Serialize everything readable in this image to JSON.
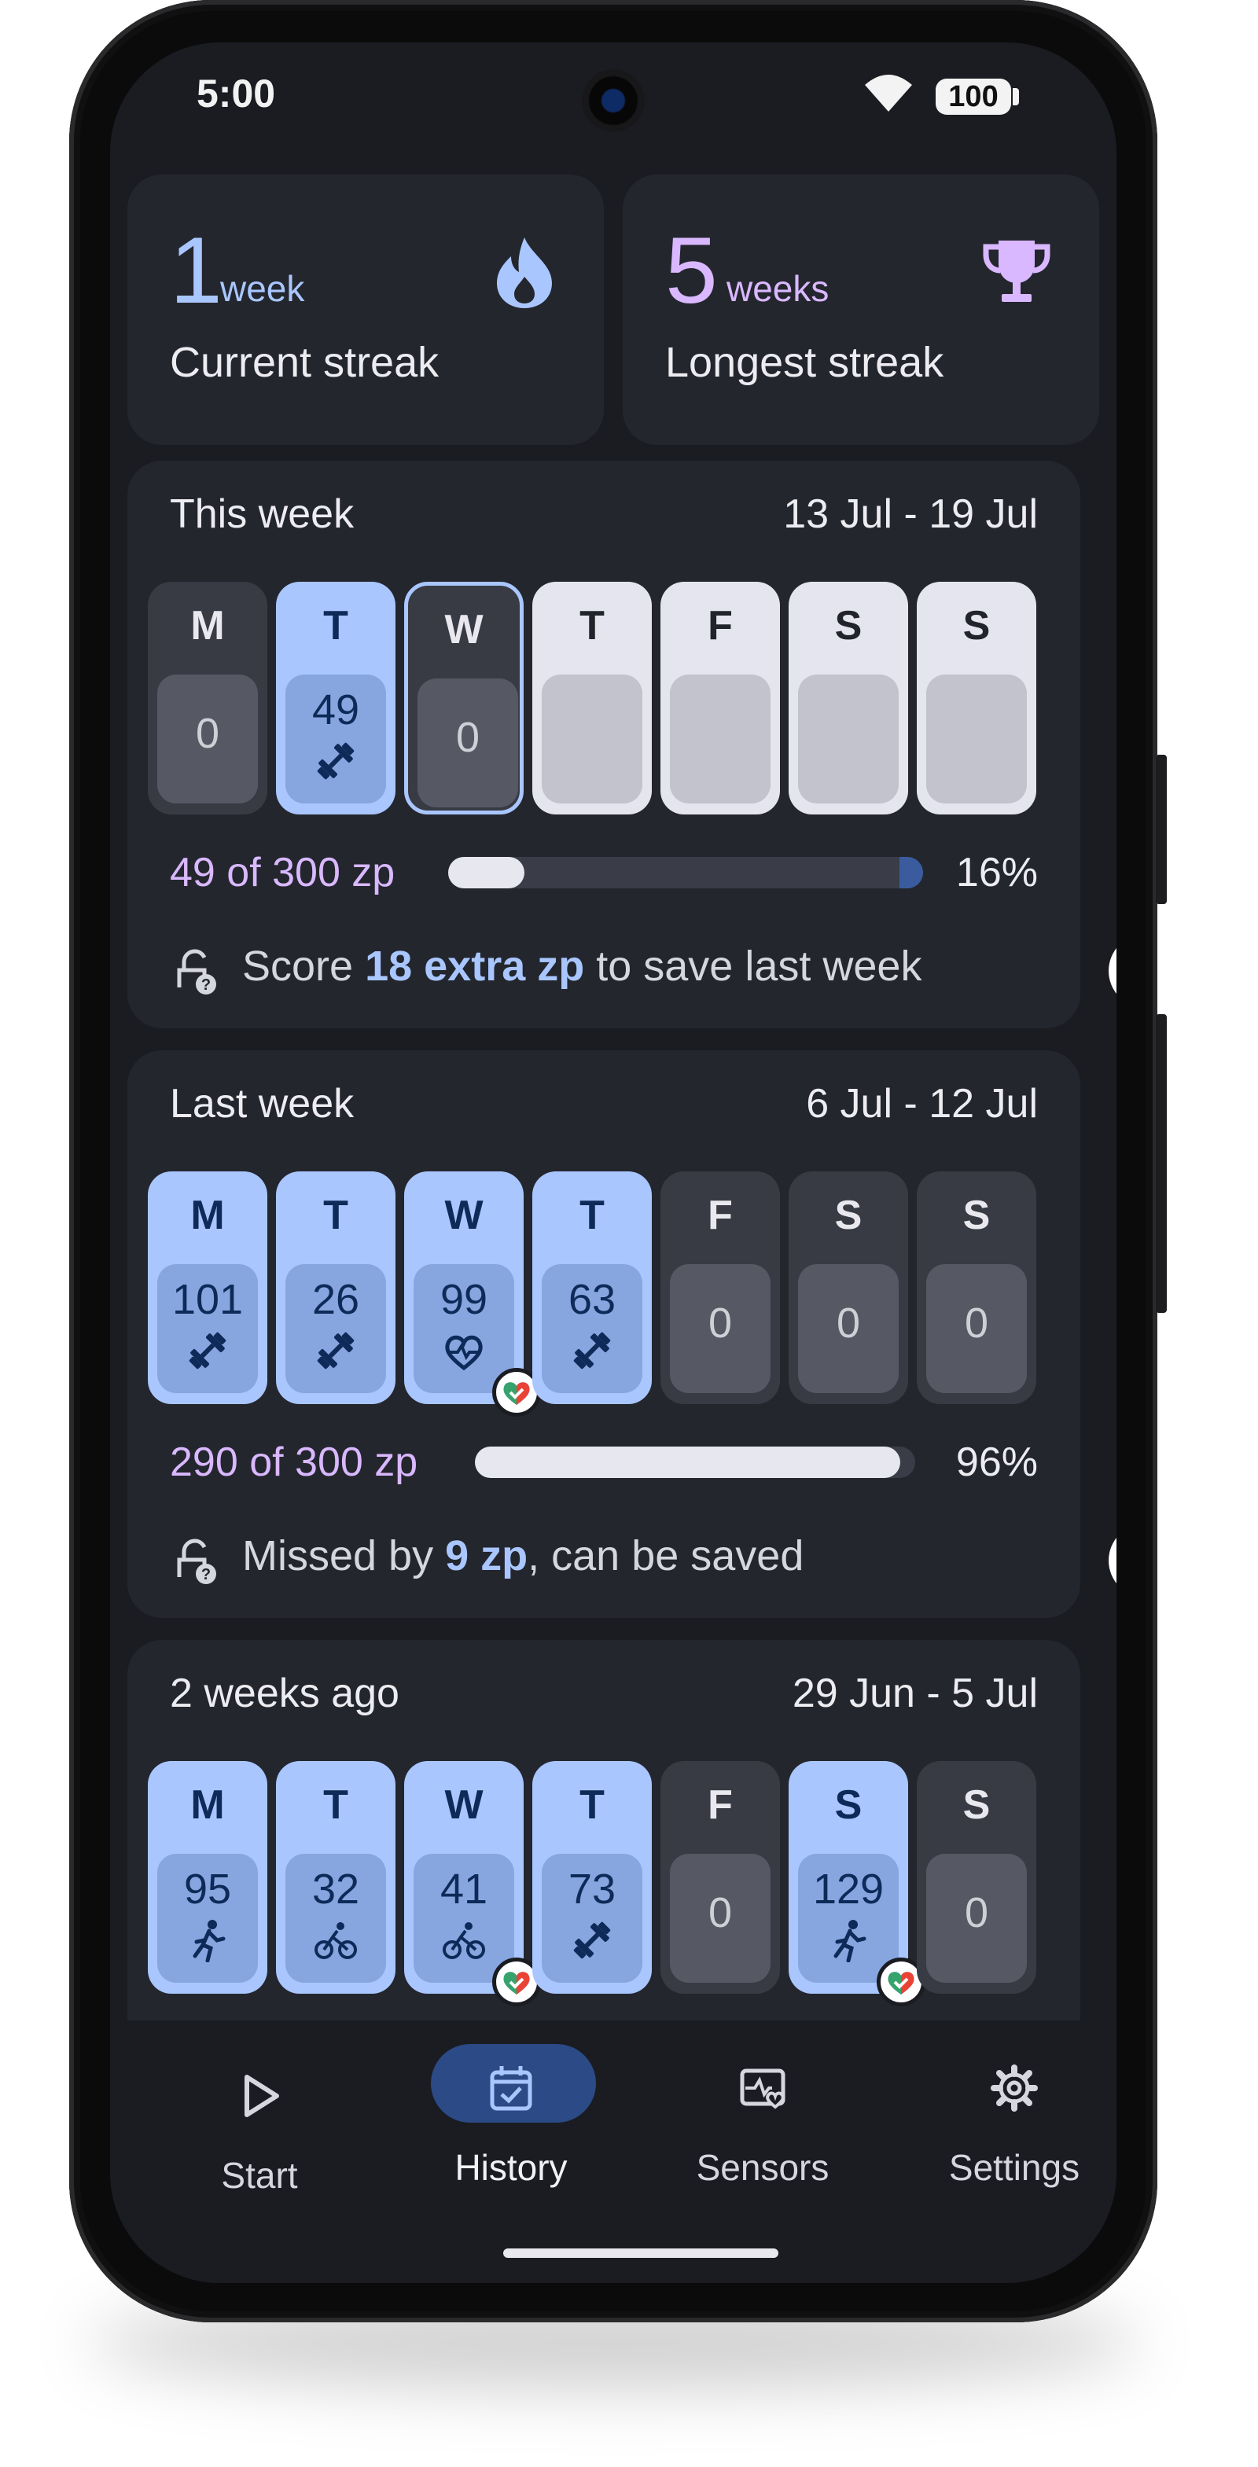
{
  "status": {
    "time": "5:00",
    "battery": "100"
  },
  "streaks": {
    "current": {
      "value": "1",
      "unit": "week",
      "label": "Current streak",
      "icon": "flame-icon"
    },
    "longest": {
      "value": "5",
      "unit": "weeks",
      "label": "Longest streak",
      "icon": "trophy-icon"
    }
  },
  "weeks": [
    {
      "title": "This week",
      "range": "13 Jul - 19 Jul",
      "days": [
        {
          "letter": "M",
          "value": "0",
          "state": "zero"
        },
        {
          "letter": "T",
          "value": "49",
          "state": "active",
          "icon": "dumbbell-icon"
        },
        {
          "letter": "W",
          "value": "0",
          "state": "today"
        },
        {
          "letter": "T",
          "value": "",
          "state": "future"
        },
        {
          "letter": "F",
          "value": "",
          "state": "future"
        },
        {
          "letter": "S",
          "value": "",
          "state": "future"
        },
        {
          "letter": "S",
          "value": "",
          "state": "future"
        }
      ],
      "progress": {
        "label": "49 of 300 zp",
        "percent_label": "16%",
        "fraction": 0.16
      },
      "note": {
        "pre": "Score ",
        "highlight": "18 extra zp",
        "post": " to save last week"
      },
      "scroll_marker": "…"
    },
    {
      "title": "Last week",
      "range": "6 Jul - 12 Jul",
      "days": [
        {
          "letter": "M",
          "value": "101",
          "state": "active",
          "icon": "dumbbell-icon"
        },
        {
          "letter": "T",
          "value": "26",
          "state": "active",
          "icon": "dumbbell-icon"
        },
        {
          "letter": "W",
          "value": "99",
          "state": "active",
          "icon": "heart-pulse-icon",
          "badge": true
        },
        {
          "letter": "T",
          "value": "63",
          "state": "active",
          "icon": "dumbbell-icon"
        },
        {
          "letter": "F",
          "value": "0",
          "state": "zero"
        },
        {
          "letter": "S",
          "value": "0",
          "state": "zero"
        },
        {
          "letter": "S",
          "value": "0",
          "state": "zero"
        }
      ],
      "progress": {
        "label": "290 of 300 zp",
        "percent_label": "96%",
        "fraction": 0.966
      },
      "note": {
        "pre": "Missed by ",
        "highlight": "9 zp",
        "post": ", can be saved"
      },
      "scroll_marker": "?"
    },
    {
      "title": "2 weeks ago",
      "range": "29 Jun - 5 Jul",
      "days": [
        {
          "letter": "M",
          "value": "95",
          "state": "active",
          "icon": "run-icon"
        },
        {
          "letter": "T",
          "value": "32",
          "state": "active",
          "icon": "bike-icon"
        },
        {
          "letter": "W",
          "value": "41",
          "state": "active",
          "icon": "bike-icon",
          "badge": true
        },
        {
          "letter": "T",
          "value": "73",
          "state": "active",
          "icon": "dumbbell-icon"
        },
        {
          "letter": "F",
          "value": "0",
          "state": "zero"
        },
        {
          "letter": "S",
          "value": "129",
          "state": "active",
          "icon": "run-icon",
          "badge": true
        },
        {
          "letter": "S",
          "value": "0",
          "state": "zero"
        }
      ]
    }
  ],
  "nav": [
    {
      "label": "Start",
      "icon": "play-icon",
      "active": false
    },
    {
      "label": "History",
      "icon": "calendar-check-icon",
      "active": true
    },
    {
      "label": "Sensors",
      "icon": "sensor-heart-icon",
      "active": false
    },
    {
      "label": "Settings",
      "icon": "gear-icon",
      "active": false
    }
  ],
  "colors": {
    "accent": "#a9c6ff",
    "zp_label": "#d9b8ff",
    "background": "#1a1c22",
    "card": "#24262e"
  }
}
